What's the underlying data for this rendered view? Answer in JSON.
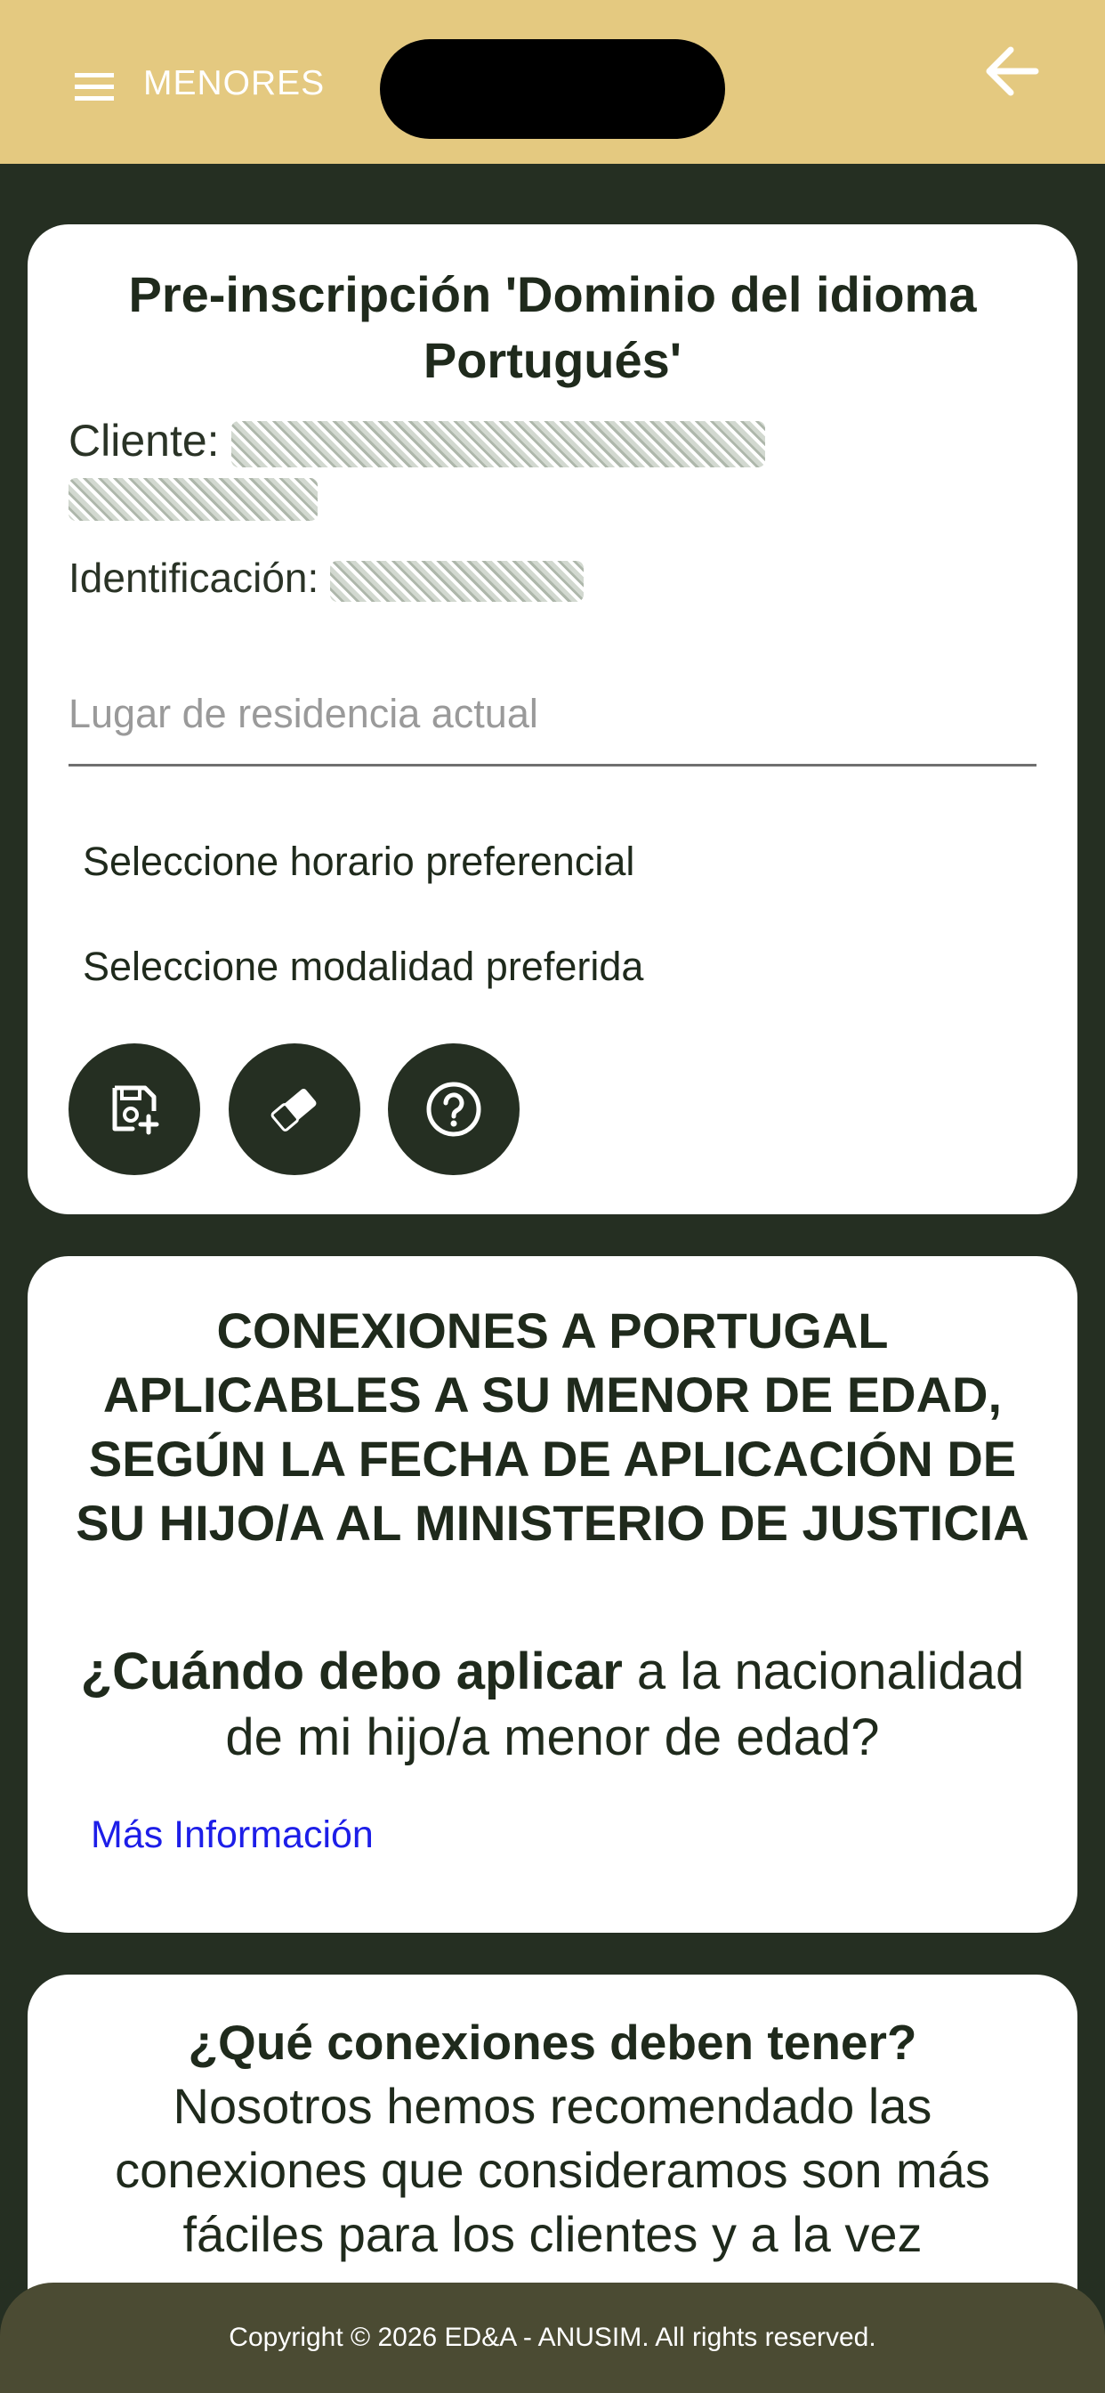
{
  "header": {
    "menu_icon": "hamburger-menu-icon",
    "title": "MENORES",
    "back_icon": "arrow-left-icon",
    "background_color": "#e4c980"
  },
  "preinscription_card": {
    "title": "Pre-inscripción 'Dominio del idioma Portugués'",
    "client_label": "Cliente:",
    "id_label": "Identificación:",
    "residence_placeholder": "Lugar de residencia actual",
    "schedule_select": "Seleccione horario preferencial",
    "modality_select": "Seleccione modalidad preferida",
    "actions": [
      {
        "icon": "save-add-icon"
      },
      {
        "icon": "eraser-icon"
      },
      {
        "icon": "help-circle-icon"
      }
    ]
  },
  "connections_card": {
    "title": "CONEXIONES A PORTUGAL APLICABLES A SU MENOR DE EDAD, SEGÚN LA FECHA DE APLICACIÓN DE SU HIJO/A AL MINISTERIO DE JUSTICIA",
    "question_bold": "¿Cuándo debo aplicar",
    "question_rest": " a la nacionalidad de mi hijo/a menor de edad?",
    "more_info_link": "Más Información",
    "link_color": "#1d1ee8"
  },
  "recommend_card": {
    "title": "¿Qué conexiones deben tener?",
    "body": "Nosotros hemos recomendado las conexiones que consideramos son más fáciles para los clientes y a la vez"
  },
  "footer": {
    "copyright": "Copyright © 2026 ED&A - ANUSIM. All rights reserved."
  },
  "theme": {
    "dark_green": "#252f22",
    "footer_color": "#4b4b33"
  }
}
